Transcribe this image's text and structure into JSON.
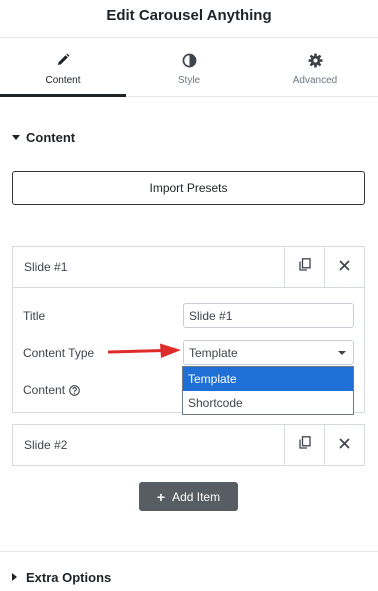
{
  "header": {
    "title": "Edit Carousel Anything"
  },
  "tabs": [
    {
      "label": "Content",
      "icon": "pencil-icon",
      "active": true
    },
    {
      "label": "Style",
      "icon": "contrast-icon",
      "active": false
    },
    {
      "label": "Advanced",
      "icon": "gear-icon",
      "active": false
    }
  ],
  "section": {
    "title": "Content",
    "expanded": true
  },
  "import_button": {
    "label": "Import Presets"
  },
  "slides": [
    {
      "title": "Slide #1",
      "expanded": true,
      "fields": {
        "title_label": "Title",
        "title_value": "Slide #1",
        "content_type_label": "Content Type",
        "content_type_value": "Template",
        "content_label": "Content"
      }
    },
    {
      "title": "Slide #2",
      "expanded": false
    }
  ],
  "dropdown": {
    "options": [
      "Template",
      "Shortcode"
    ],
    "selected": "Template"
  },
  "add_item": {
    "label": "Add Item"
  },
  "extra_section": {
    "title": "Extra Options",
    "expanded": false
  },
  "colors": {
    "accent": "#1f6fd6",
    "annotation_arrow": "#e02b2b",
    "add_button_bg": "#585d63"
  }
}
